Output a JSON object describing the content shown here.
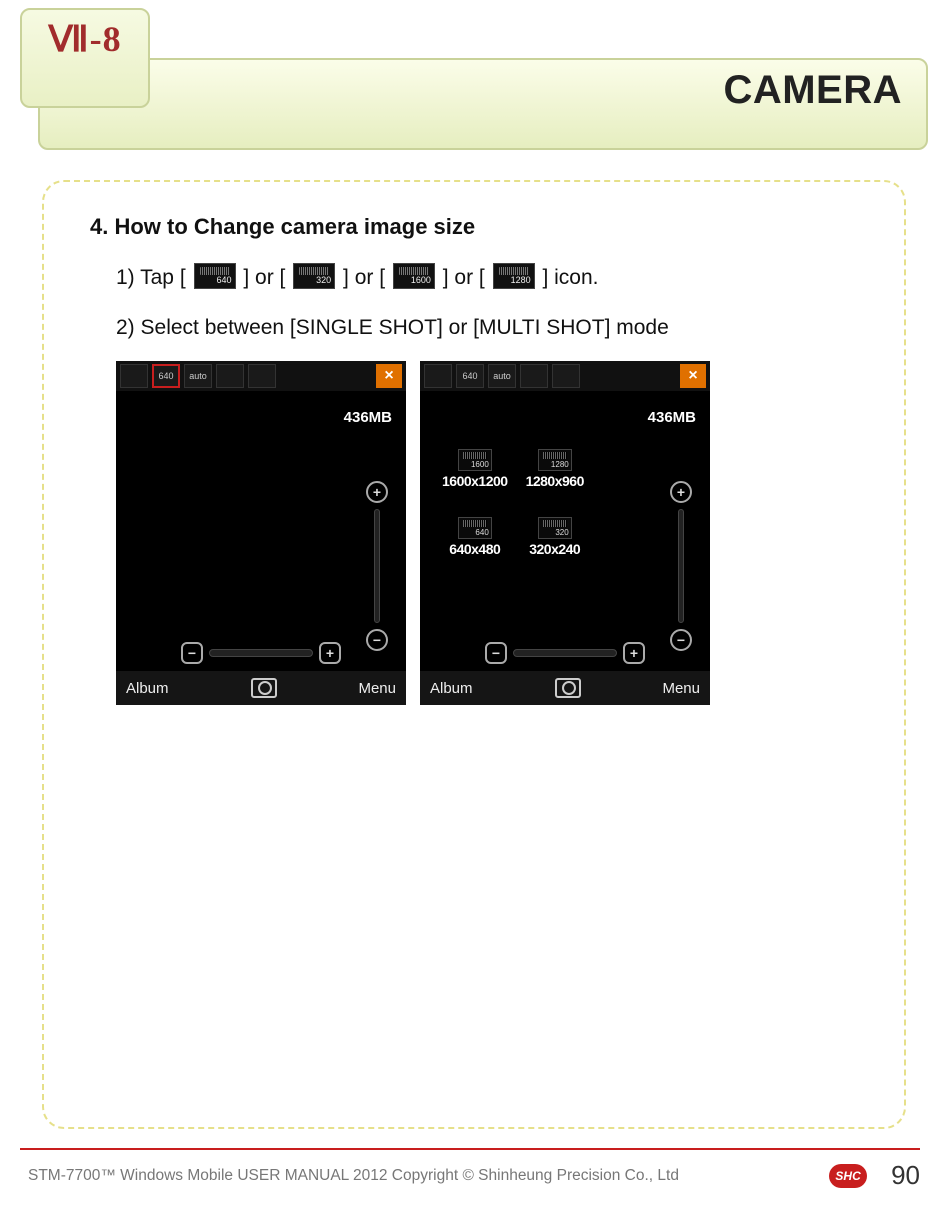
{
  "chapter": "Ⅶ-8",
  "page_title": "CAMERA",
  "section_heading": "4. How to Change camera image size",
  "step1": {
    "prefix": "1) Tap [",
    "sep": "] or [",
    "suffix": "] icon.",
    "icons": [
      "640",
      "320",
      "1600",
      "1280"
    ]
  },
  "step2": "2) Select between [SINGLE SHOT] or [MULTI SHOT] mode",
  "phone_common": {
    "storage": "436MB",
    "bottom_left": "Album",
    "bottom_right": "Menu",
    "toolbar_icons": [
      "cam",
      "640",
      "auto",
      "fx",
      "set"
    ],
    "close_glyph": "×",
    "zoom_in": "+",
    "zoom_out": "−",
    "bright_minus": "−",
    "bright_plus": "+"
  },
  "phone2_toolbar_icons": [
    "cam",
    "640",
    "auto",
    "fx",
    "set"
  ],
  "resolutions": [
    {
      "short": "1600",
      "label": "1600x1200"
    },
    {
      "short": "1280",
      "label": "1280x960"
    },
    {
      "short": "640",
      "label": "640x480"
    },
    {
      "short": "320",
      "label": "320x240"
    }
  ],
  "footer": {
    "text": "STM-7700™ Windows Mobile USER MANUAL  2012 Copyright © Shinheung Precision Co., Ltd",
    "badge": "SHC",
    "page": "90"
  }
}
